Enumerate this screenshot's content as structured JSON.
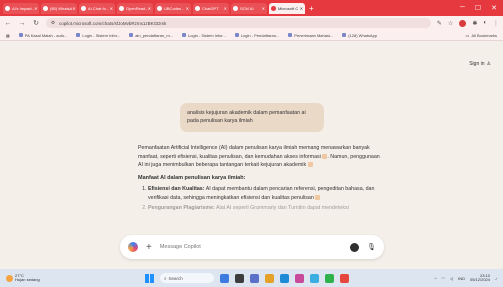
{
  "browser": {
    "tabs": [
      {
        "label": "AI's Impact -"
      },
      {
        "label": "(85) WhatsA"
      },
      {
        "label": "AI Chat fo -"
      },
      {
        "label": "OpenRead -"
      },
      {
        "label": "UBCodes -"
      },
      {
        "label": "ChatGPT"
      },
      {
        "label": "SCM AI"
      },
      {
        "label": "Microsoft C",
        "active": true
      }
    ],
    "url": "copilot.microsoft.com/chats/sfJoMvbRzms1zBKGDmk",
    "bookmarks": [
      {
        "label": "PA Kasal Malah - auto..."
      },
      {
        "label": "Login - Sistem Infor..."
      },
      {
        "label": "ain_pendaftaran_m..."
      },
      {
        "label": "Login - Sistem Infor..."
      },
      {
        "label": "Login - Pendaftaran..."
      },
      {
        "label": "Penerimaan Mahasi..."
      },
      {
        "label": "(128) WhatsApp"
      }
    ],
    "all_bookmarks": "All Bookmarks"
  },
  "page": {
    "signin": "Sign in",
    "user_message": "analisis kejujuran akademik dalam pemanfaatan ai pada penulisan karya ilmiah",
    "answer": {
      "intro_1": "Pemanfaatan Artificial Intelligence (AI) dalam penulisan karya ilmiah memang menawarkan banyak manfaat, seperti efisiensi, kualitas penulisan, dan kemudahan akses informasi",
      "intro_2": ". Namun, penggunaan AI ini juga menimbulkan beberapa tantangan terkait kejujuran akademik",
      "heading": "Manfaat AI dalam penulisan karya ilmiah:",
      "items": [
        {
          "title": "Efisiensi dan Kualitas:",
          "text": "AI dapat membantu dalam pencarian referensi, pengeditan bahasa, dan verifikasi data, sehingga meningkatkan efisiensi dan kualitas penulisan"
        },
        {
          "title": "Pengurangan Plagiarisme:",
          "text": "Alat AI seperti Grammarly dan Turnitin dapat mendeteksi"
        }
      ]
    },
    "composer_placeholder": "Message Copilot"
  },
  "taskbar": {
    "weather_temp": "27°C",
    "weather_desc": "Hujan sedang",
    "search_label": "Search",
    "lang": "IND",
    "time": "23:10",
    "date": "05/12/2024"
  },
  "colors": {
    "accent_bar": "#e6393f",
    "page_bg": "#f4efe9",
    "user_bubble": "#ebd9c8"
  }
}
